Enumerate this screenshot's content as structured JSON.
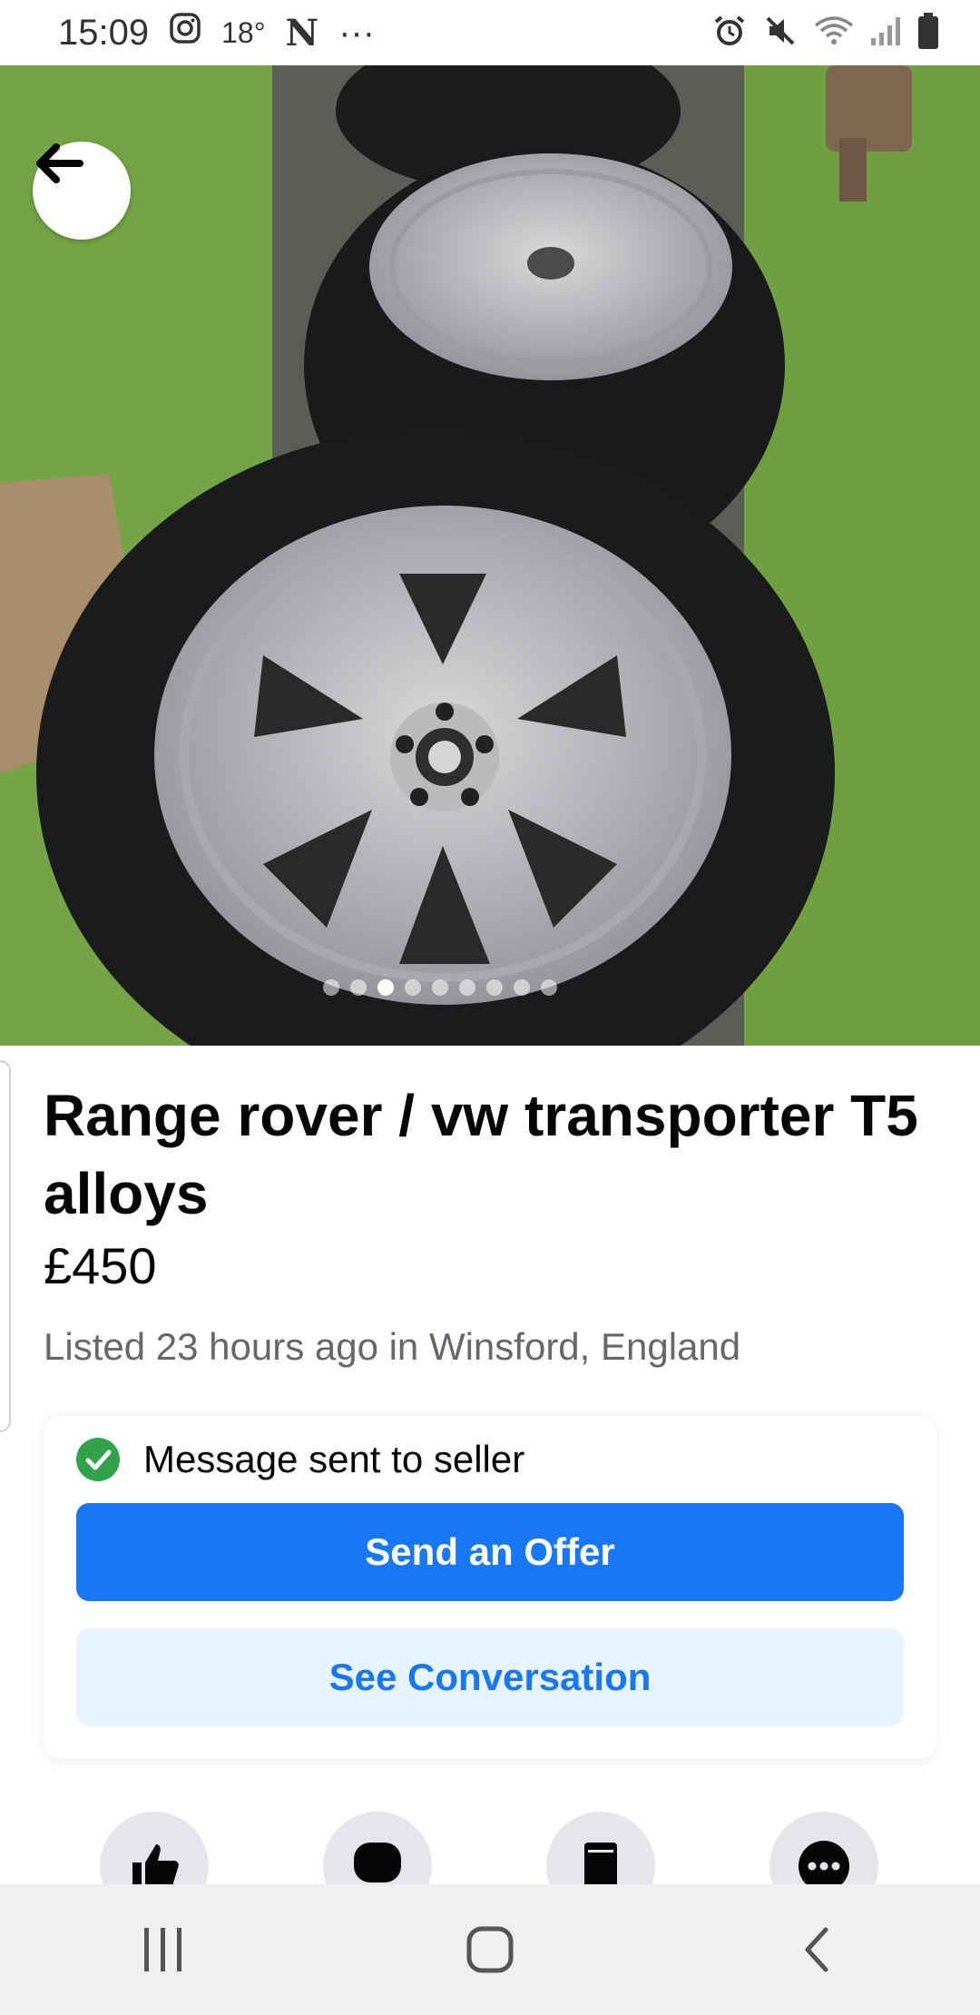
{
  "status_bar": {
    "time": "15:09",
    "temperature": "18°",
    "app_letter": "N",
    "more": "···",
    "icons_left": [
      "instagram-icon"
    ],
    "icons_right": [
      "alarm-icon",
      "mute-icon",
      "wifi-icon",
      "signal-icon",
      "battery-icon"
    ]
  },
  "gallery": {
    "image_count": 9,
    "active_index": 2
  },
  "listing": {
    "title": "Range rover / vw transporter T5 alloys",
    "price": "£450",
    "listed": "Listed 23 hours ago in Winsford, England"
  },
  "contact": {
    "message_status": "Message sent to seller",
    "offer_label": "Send an Offer",
    "conversation_label": "See Conversation"
  },
  "actions": [
    "like-icon",
    "messenger-icon",
    "save-icon",
    "more-icon"
  ],
  "nav": [
    "recent-apps-icon",
    "home-icon",
    "back-icon"
  ],
  "colors": {
    "primary": "#1877f2",
    "primary_light": "#e7f3ff",
    "success": "#31a24c",
    "secondary_text": "#65676b"
  }
}
